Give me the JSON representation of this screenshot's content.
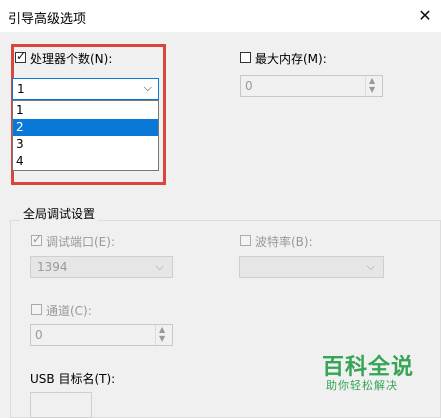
{
  "window": {
    "title": "引导高级选项",
    "close_glyph": "✕"
  },
  "processors": {
    "checkbox_label": "处理器个数(N):",
    "checked": true,
    "selected_value": "1",
    "options": [
      "1",
      "2",
      "3",
      "4"
    ],
    "highlighted": "2"
  },
  "max_memory": {
    "checkbox_label": "最大内存(M):",
    "checked": false,
    "value": "0"
  },
  "global_debug": {
    "group_title": "全局调试设置",
    "debug_port": {
      "checkbox_label": "调试端口(E):",
      "checked": true,
      "value": "1394"
    },
    "baud_rate": {
      "checkbox_label": "波特率(B):",
      "checked": false,
      "value": ""
    },
    "channel": {
      "checkbox_label": "通道(C):",
      "checked": false,
      "value": "0"
    },
    "usb_target": {
      "label": "USB 目标名(T):"
    }
  },
  "watermark": {
    "title": "百科全说",
    "subtitle": "助你轻松解决"
  },
  "colors": {
    "accent": "#0a78d7",
    "highlight_box": "#d9463f",
    "watermark": "#35a455"
  }
}
